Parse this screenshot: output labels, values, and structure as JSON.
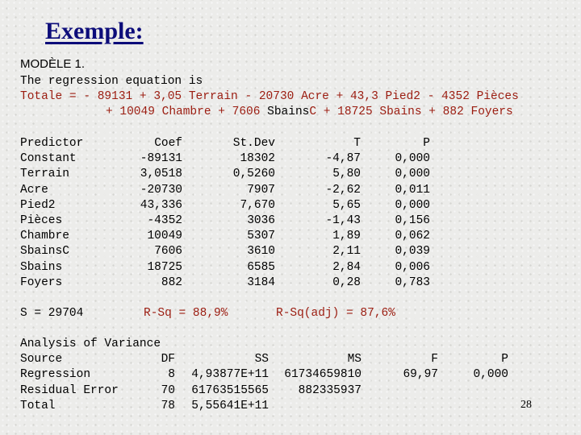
{
  "title": "Exemple:",
  "model_label": "MODÈLE 1.",
  "equation_intro": "The regression equation is",
  "equation_line1": [
    {
      "t": "Totale = - 89131 + 3,05 Terrain - ",
      "c": "red"
    },
    {
      "t": "20730 Acre + 43,3 Pied2 - 4352 Pièces",
      "c": "red"
    }
  ],
  "equation_line2": [
    {
      "t": "+ 10049 Chambre + 7606 ",
      "c": "red"
    },
    {
      "t": "Sbains",
      "c": "blk"
    },
    {
      "t": "C + 18725 Sbains + 882 Foyers",
      "c": "red"
    }
  ],
  "coef_table": {
    "headers": [
      "Predictor",
      "Coef",
      "St.Dev",
      "T",
      "P"
    ],
    "rows": [
      [
        "Constant",
        "-89131",
        "18302",
        "-4,87",
        "0,000"
      ],
      [
        "Terrain",
        "3,0518",
        "0,5260",
        "5,80",
        "0,000"
      ],
      [
        "Acre",
        "-20730",
        "7907",
        "-2,62",
        "0,011"
      ],
      [
        "Pied2",
        "43,336",
        "7,670",
        "5,65",
        "0,000"
      ],
      [
        "Pièces",
        "-4352",
        "3036",
        "-1,43",
        "0,156"
      ],
      [
        "Chambre",
        "10049",
        "5307",
        "1,89",
        "0,062"
      ],
      [
        "SbainsC",
        "7606",
        "3610",
        "2,11",
        "0,039"
      ],
      [
        "Sbains",
        "18725",
        "6585",
        "2,84",
        "0,006"
      ],
      [
        "Foyers",
        "882",
        "3184",
        "0,28",
        "0,783"
      ]
    ]
  },
  "fit": {
    "s": "S = 29704",
    "rsq": "R-Sq = 88,9%",
    "rsq_adj": "R-Sq(adj) = 87,6%"
  },
  "anova": {
    "heading": "Analysis of Variance",
    "headers": [
      "Source",
      "DF",
      "SS",
      "MS",
      "F",
      "P"
    ],
    "rows": [
      [
        "Regression",
        "8",
        "4,93877E+11",
        "61734659810",
        "69,97",
        "0,000"
      ],
      [
        "Residual Error",
        "70",
        "61763515565",
        "882335937",
        "",
        ""
      ],
      [
        "Total",
        "78",
        "5,55641E+11",
        "",
        "",
        ""
      ]
    ]
  },
  "page_number": "28",
  "colors": {
    "title": "#0d0d7a",
    "highlight": "#9b1c10"
  }
}
